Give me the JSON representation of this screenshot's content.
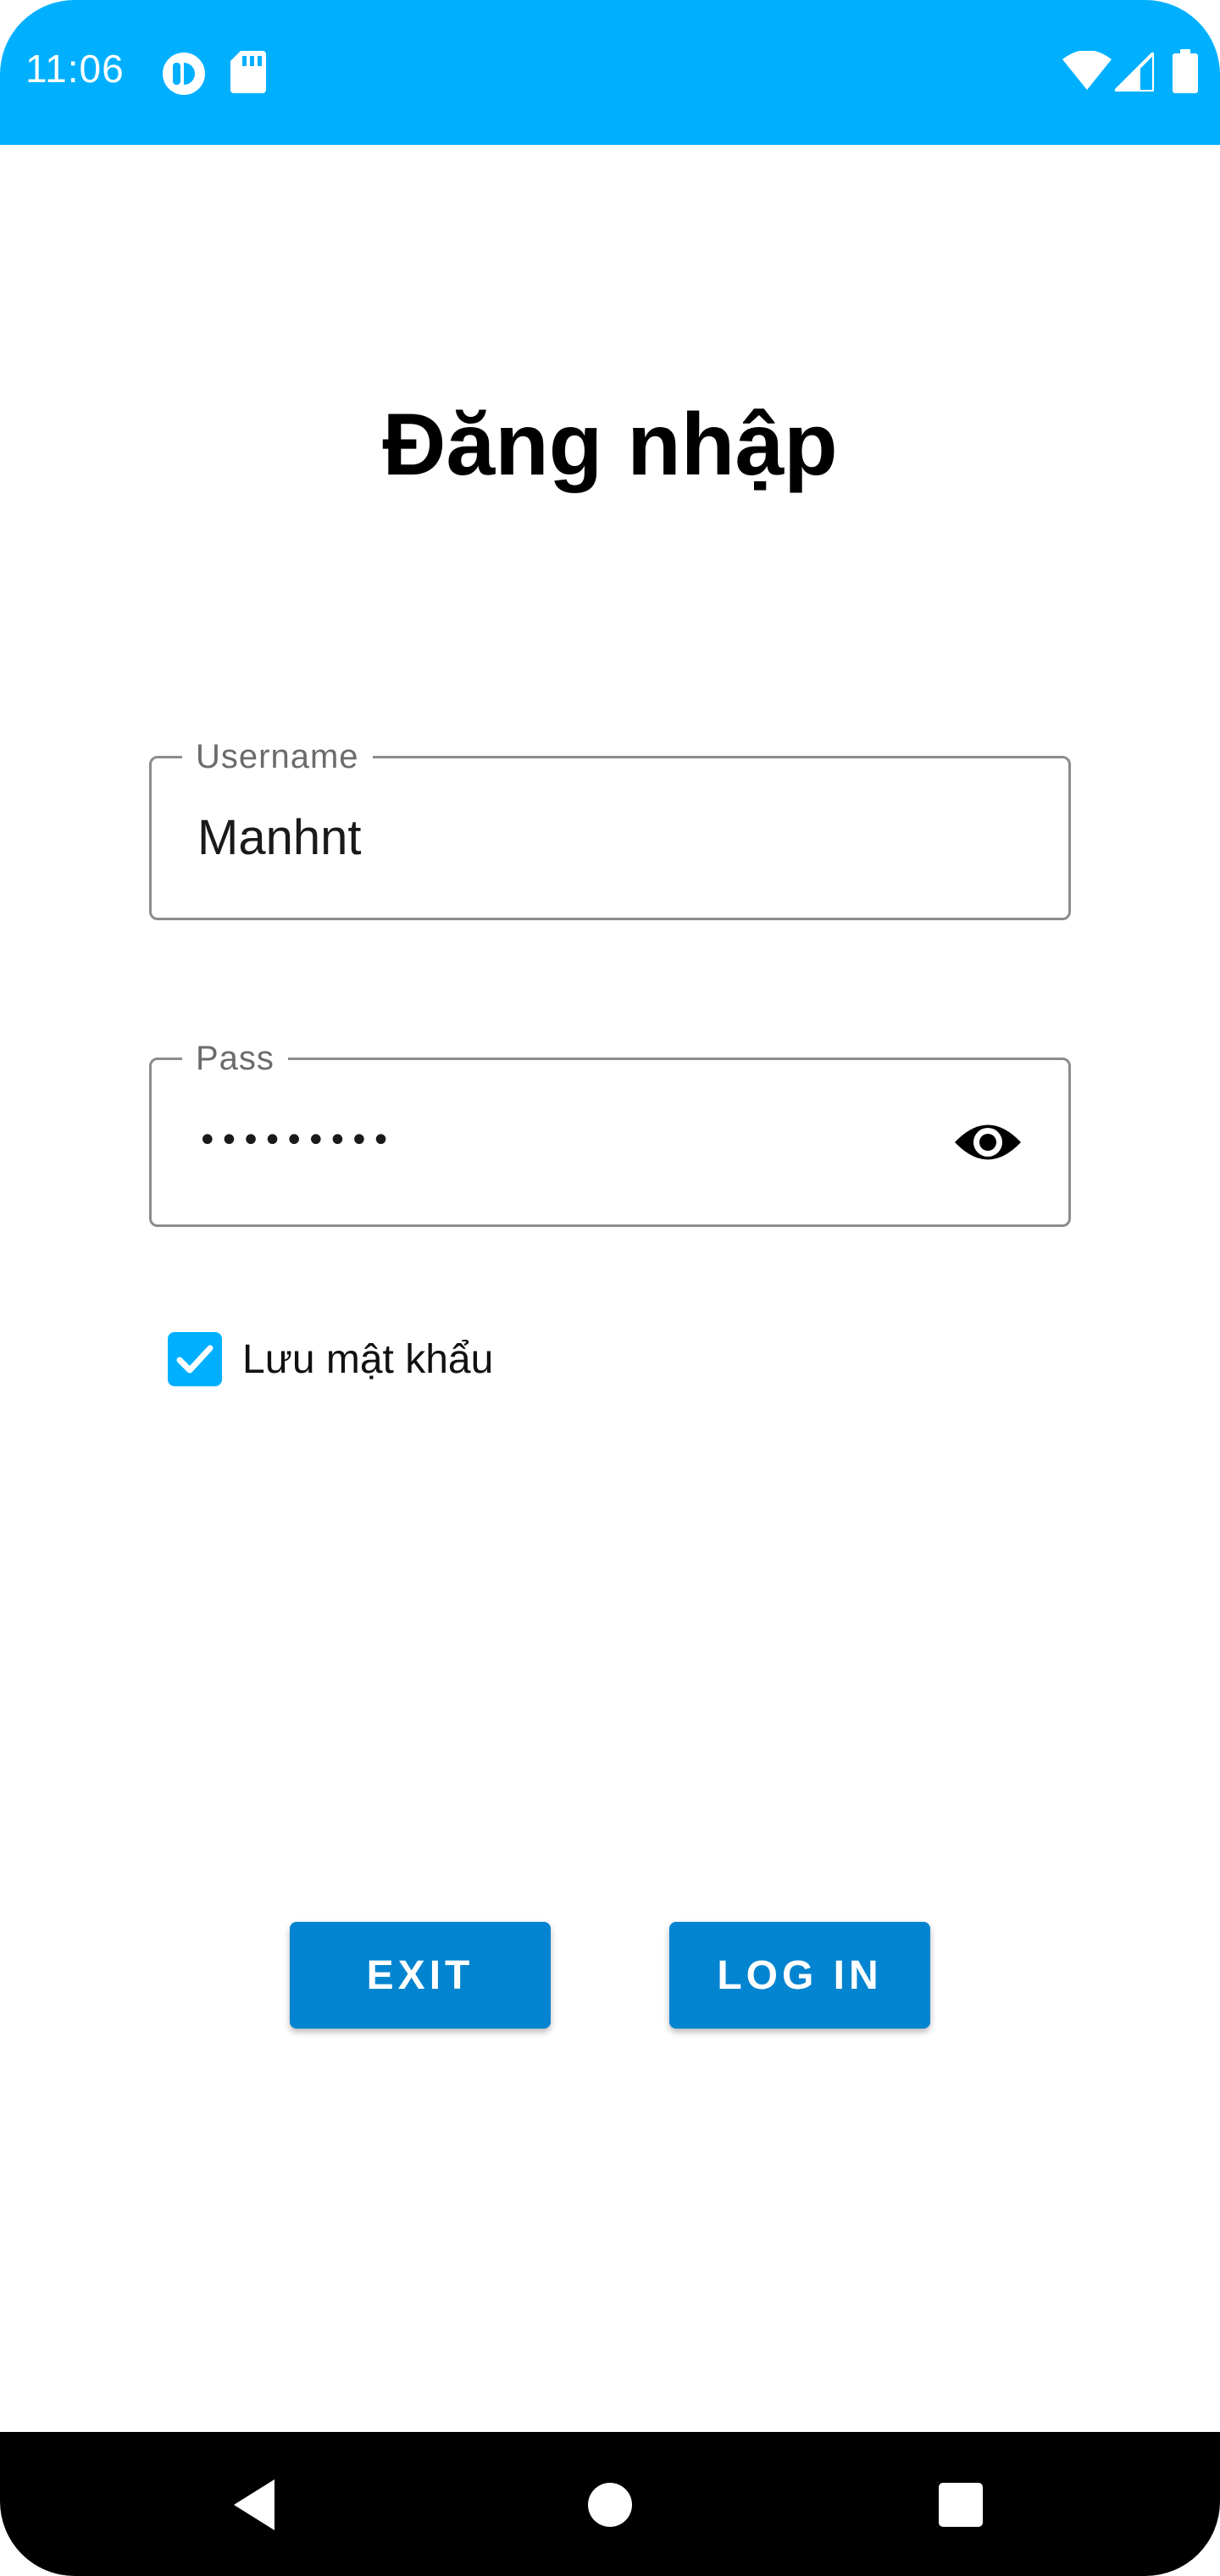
{
  "colors": {
    "status_bar": "#00b0ff",
    "accent": "#00b0ff",
    "button": "#0284d0",
    "nav_bar": "#000000"
  },
  "status_bar": {
    "time": "11:06",
    "left_icons": [
      "sync-icon",
      "sd-card-icon"
    ],
    "right_icons": [
      "wifi-icon",
      "cell-signal-icon",
      "battery-icon"
    ]
  },
  "page": {
    "title": "Đăng nhập"
  },
  "username_field": {
    "label": "Username",
    "value": "Manhnt"
  },
  "password_field": {
    "label": "Pass",
    "masked_value": "•••••••••",
    "toggle_icon": "eye-icon"
  },
  "remember": {
    "label": "Lưu mật khẩu",
    "checked": true
  },
  "buttons": {
    "exit": "EXIT",
    "login": "LOG IN"
  },
  "nav_bar": {
    "icons": [
      "back-icon",
      "home-icon",
      "recents-icon"
    ]
  }
}
